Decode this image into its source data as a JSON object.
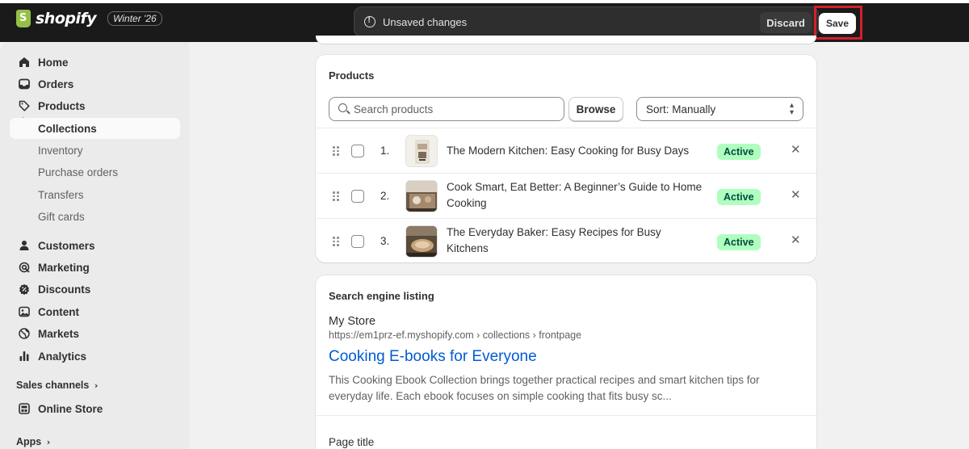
{
  "brand": {
    "name": "shopify",
    "edition": "Winter '26"
  },
  "topbar": {
    "message": "Unsaved changes",
    "discard_label": "Discard",
    "save_label": "Save"
  },
  "sidebar": {
    "items": [
      {
        "label": "Home",
        "icon": "home-icon"
      },
      {
        "label": "Orders",
        "icon": "inbox-icon"
      },
      {
        "label": "Products",
        "icon": "tag-icon"
      },
      {
        "label": "Collections",
        "active": true
      },
      {
        "label": "Inventory"
      },
      {
        "label": "Purchase orders"
      },
      {
        "label": "Transfers"
      },
      {
        "label": "Gift cards"
      },
      {
        "label": "Customers",
        "icon": "person-icon"
      },
      {
        "label": "Marketing",
        "icon": "target-icon"
      },
      {
        "label": "Discounts",
        "icon": "discount-icon"
      },
      {
        "label": "Content",
        "icon": "content-icon"
      },
      {
        "label": "Markets",
        "icon": "globe-icon"
      },
      {
        "label": "Analytics",
        "icon": "bar-chart-icon"
      }
    ],
    "sales_channels_label": "Sales channels",
    "online_store_label": "Online Store",
    "apps_label": "Apps"
  },
  "products_card": {
    "title": "Products",
    "search_placeholder": "Search products",
    "browse_label": "Browse",
    "sort_label": "Sort: Manually",
    "rows": [
      {
        "index": "1.",
        "title_line1": "The Modern Kitchen: Easy Cooking for Busy Days",
        "title_line2": "",
        "status": "Active"
      },
      {
        "index": "2.",
        "title_line1": "Cook Smart, Eat Better: A Beginner’s Guide to Home",
        "title_line2": "Cooking",
        "status": "Active"
      },
      {
        "index": "3.",
        "title_line1": "The Everyday Baker: Easy Recipes for Busy",
        "title_line2": "Kitchens",
        "status": "Active"
      }
    ]
  },
  "seo_card": {
    "title": "Search engine listing",
    "store_name": "My Store",
    "url": "https://em1prz-ef.myshopify.com › collections › frontpage",
    "listing_title": "Cooking E-books for Everyone",
    "desc_line1": "This Cooking Ebook Collection brings together practical recipes and smart kitchen tips for",
    "desc_line2": "everyday life. Each ebook focuses on simple cooking that fits busy sc...",
    "page_title_label": "Page title"
  },
  "colors": {
    "accent_link": "#005bd3",
    "badge_bg": "#affebf",
    "badge_text": "#014b40",
    "highlight": "#d2202a"
  }
}
